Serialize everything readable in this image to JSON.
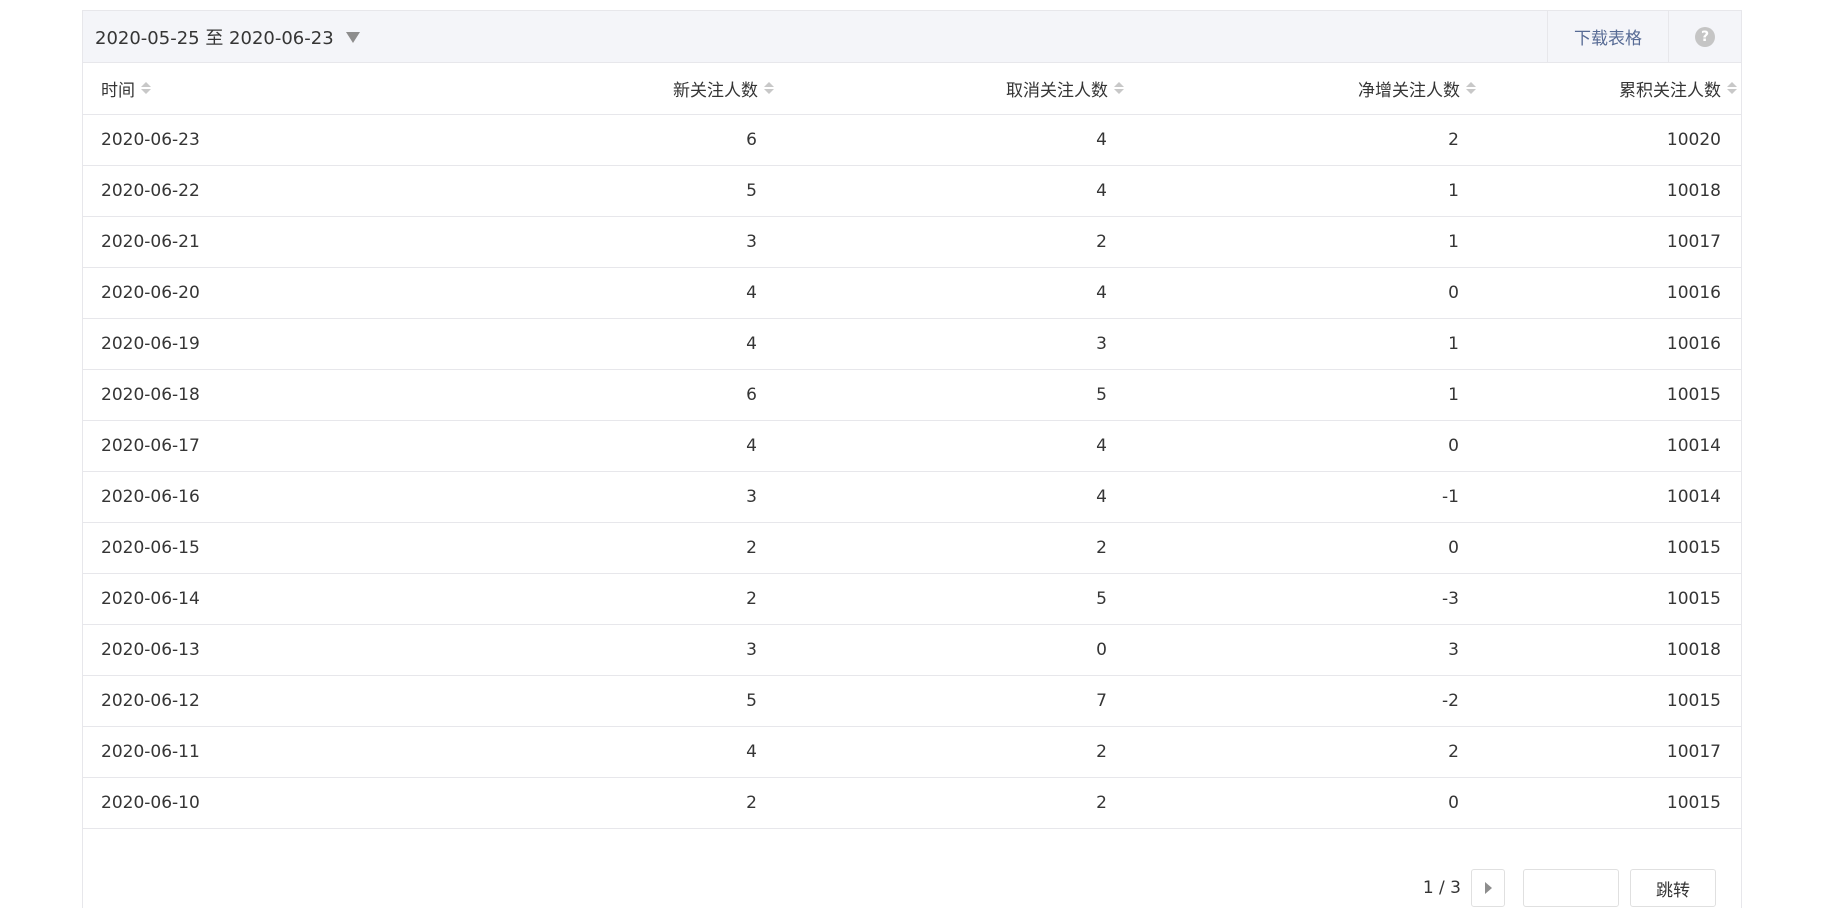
{
  "toolbar": {
    "date_range": "2020-05-25 至 2020-06-23",
    "download_label": "下载表格",
    "help_glyph": "?"
  },
  "table": {
    "headers": [
      "时间",
      "新关注人数",
      "取消关注人数",
      "净增关注人数",
      "累积关注人数"
    ],
    "rows": [
      [
        "2020-06-23",
        "6",
        "4",
        "2",
        "10020"
      ],
      [
        "2020-06-22",
        "5",
        "4",
        "1",
        "10018"
      ],
      [
        "2020-06-21",
        "3",
        "2",
        "1",
        "10017"
      ],
      [
        "2020-06-20",
        "4",
        "4",
        "0",
        "10016"
      ],
      [
        "2020-06-19",
        "4",
        "3",
        "1",
        "10016"
      ],
      [
        "2020-06-18",
        "6",
        "5",
        "1",
        "10015"
      ],
      [
        "2020-06-17",
        "4",
        "4",
        "0",
        "10014"
      ],
      [
        "2020-06-16",
        "3",
        "4",
        "-1",
        "10014"
      ],
      [
        "2020-06-15",
        "2",
        "2",
        "0",
        "10015"
      ],
      [
        "2020-06-14",
        "2",
        "5",
        "-3",
        "10015"
      ],
      [
        "2020-06-13",
        "3",
        "0",
        "3",
        "10018"
      ],
      [
        "2020-06-12",
        "5",
        "7",
        "-2",
        "10015"
      ],
      [
        "2020-06-11",
        "4",
        "2",
        "2",
        "10017"
      ],
      [
        "2020-06-10",
        "2",
        "2",
        "0",
        "10015"
      ]
    ]
  },
  "pager": {
    "page_info": "1 / 3",
    "jump_label": "跳转",
    "jump_value": ""
  },
  "colors": {
    "link": "#576b95",
    "border": "#e7e7eb",
    "toolbar_bg": "#f4f5f9"
  },
  "icons": {
    "date_dropdown": "caret-down-icon",
    "help": "question-circle-icon",
    "sort": "sort-icon",
    "next_page": "caret-right-icon"
  }
}
